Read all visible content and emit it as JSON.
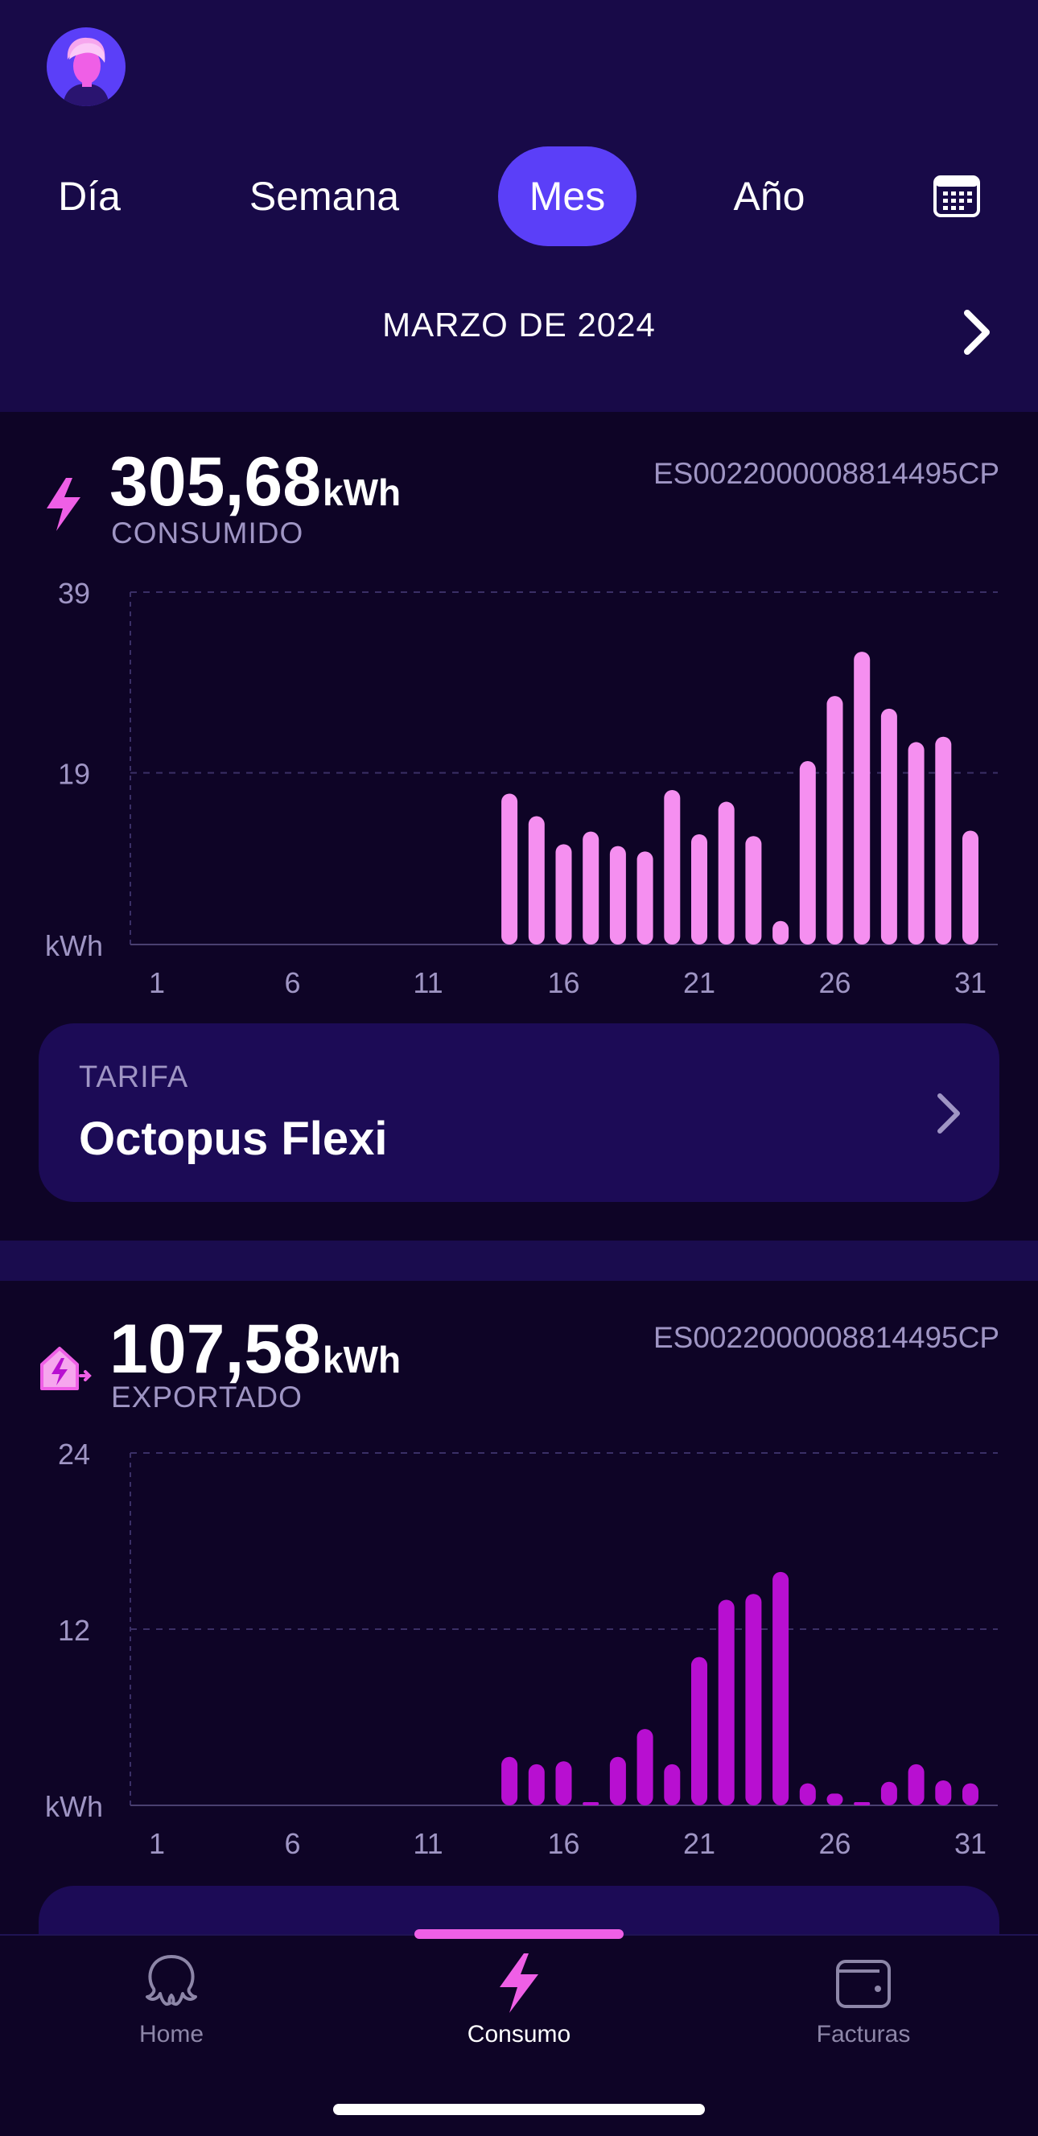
{
  "header": {
    "avatar_icon": "user-avatar",
    "tabs": [
      {
        "label": "Día",
        "active": false
      },
      {
        "label": "Semana",
        "active": false
      },
      {
        "label": "Mes",
        "active": true
      },
      {
        "label": "Año",
        "active": false
      }
    ],
    "calendar_icon": "calendar-icon",
    "period": "MARZO DE 2024",
    "next_icon": "chevron-right-icon"
  },
  "consumption": {
    "icon": "lightning-icon",
    "value": "305,68",
    "unit": "kWh",
    "label": "CONSUMIDO",
    "meter_id": "ES0022000008814495CP"
  },
  "export": {
    "icon": "house-export-icon",
    "value": "107,58",
    "unit": "kWh",
    "label": "EXPORTADO",
    "meter_id": "ES0022000008814495CP"
  },
  "tariff": {
    "label": "TARIFA",
    "name": "Octopus Flexi",
    "arrow_icon": "chevron-right-icon"
  },
  "bottom_nav": [
    {
      "label": "Home",
      "icon": "octopus-icon",
      "active": false
    },
    {
      "label": "Consumo",
      "icon": "lightning-icon",
      "active": true
    },
    {
      "label": "Facturas",
      "icon": "wallet-icon",
      "active": false
    }
  ],
  "colors": {
    "header_bg": "#180a48",
    "page_bg": "#0e0426",
    "accent_purple": "#5b3ff8",
    "consumption_bar": "#f58ff0",
    "export_bar": "#b80fd1",
    "muted_text": "#9f95c4"
  },
  "chart_data": [
    {
      "type": "bar",
      "categories": [
        1,
        2,
        3,
        4,
        5,
        6,
        7,
        8,
        9,
        10,
        11,
        12,
        13,
        14,
        15,
        16,
        17,
        18,
        19,
        20,
        21,
        22,
        23,
        24,
        25,
        26,
        27,
        28,
        29,
        30,
        31
      ],
      "values": [
        0,
        0,
        0,
        0,
        0,
        0,
        0,
        0,
        0,
        0,
        0,
        0,
        0,
        16.7,
        14.2,
        11.1,
        12.5,
        10.9,
        10.3,
        17.1,
        12.2,
        15.8,
        12.0,
        2.6,
        20.3,
        27.5,
        32.4,
        26.1,
        22.4,
        23.0,
        12.6
      ],
      "tick_labels": [
        "1",
        "6",
        "11",
        "16",
        "21",
        "26",
        "31"
      ],
      "tick_positions": [
        1,
        6,
        11,
        16,
        21,
        26,
        31
      ],
      "ylim": [
        0,
        39
      ],
      "y_ticks": [
        "39",
        "19"
      ],
      "y_tick_values": [
        39,
        19
      ],
      "ylabel": "kWh",
      "grid": true,
      "color": "#f58ff0"
    },
    {
      "type": "bar",
      "categories": [
        1,
        2,
        3,
        4,
        5,
        6,
        7,
        8,
        9,
        10,
        11,
        12,
        13,
        14,
        15,
        16,
        17,
        18,
        19,
        20,
        21,
        22,
        23,
        24,
        25,
        26,
        27,
        28,
        29,
        30,
        31
      ],
      "values": [
        0,
        0,
        0,
        0,
        0,
        0,
        0,
        0,
        0,
        0,
        0,
        0,
        0,
        3.3,
        2.8,
        3.0,
        0.1,
        3.3,
        5.2,
        2.8,
        10.1,
        14.0,
        14.4,
        15.9,
        1.5,
        0.8,
        0.1,
        1.6,
        2.8,
        1.7,
        1.5
      ],
      "tick_labels": [
        "1",
        "6",
        "11",
        "16",
        "21",
        "26",
        "31"
      ],
      "tick_positions": [
        1,
        6,
        11,
        16,
        21,
        26,
        31
      ],
      "ylim": [
        0,
        24
      ],
      "y_ticks": [
        "24",
        "12"
      ],
      "y_tick_values": [
        24,
        12
      ],
      "ylabel": "kWh",
      "grid": true,
      "color": "#b80fd1"
    }
  ]
}
